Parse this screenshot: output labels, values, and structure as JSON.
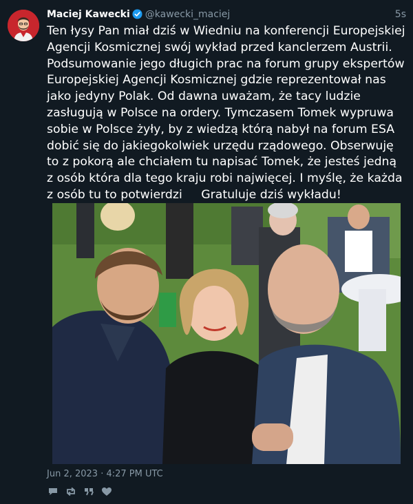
{
  "tweet": {
    "author_name": "Maciej Kawecki",
    "handle": "@kawecki_maciej",
    "relative_time": "5s",
    "verified_icon": "verified-badge-icon",
    "text": "Ten łysy Pan miał dziś w Wiedniu na konferencji Europejskiej Agencji Kosmicznej swój wykład przed kanclerzem Austrii. Podsumowanie jego długich prac na forum grupy ekspertów Europejskiej Agencji Kosmicznej gdzie reprezentował nas jako jedyny Polak. Od dawna uważam, że tacy ludzie zasługują w Polsce na ordery. Tymczasem Tomek wypruwa sobie w Polsce żyły, by z wiedzą którą nabył na forum ESA dobić się do jakiegokolwiek urzędu rządowego. Obserwuję to z pokorą ale chciałem tu napisać Tomek, że jesteś jedną z osób która dla tego kraju robi najwięcej. I myślę, że każda z osób tu to potwierdzi     Gratuluje dziś wykładu!",
    "date": "Jun 2, 2023 · 4:27 PM UTC",
    "photo_description": "selfie of three people at an outdoor event on grass"
  },
  "actions": [
    {
      "name": "reply-icon"
    },
    {
      "name": "retweet-icon"
    },
    {
      "name": "quote-icon"
    },
    {
      "name": "like-icon"
    }
  ],
  "colors": {
    "background": "#111a22",
    "text": "#ffffff",
    "muted": "#8899a6",
    "verified": "#1d9bf0",
    "avatar_bg": "#c8262d"
  }
}
